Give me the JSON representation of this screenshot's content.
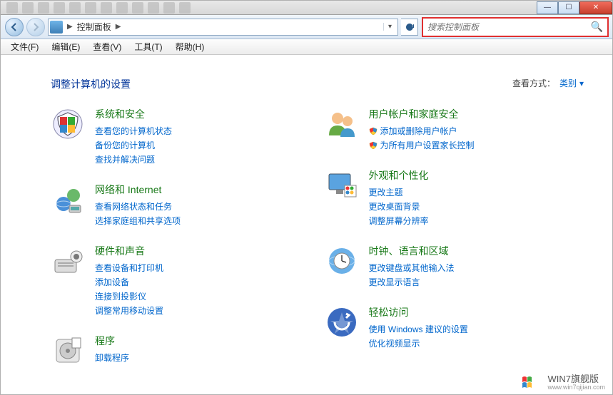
{
  "breadcrumb": {
    "root": "控制面板"
  },
  "search": {
    "placeholder": "搜索控制面板"
  },
  "menus": {
    "file": "文件(F)",
    "edit": "编辑(E)",
    "view": "查看(V)",
    "tools": "工具(T)",
    "help": "帮助(H)"
  },
  "heading": "调整计算机的设置",
  "viewby": {
    "label": "查看方式：",
    "value": "类别"
  },
  "categories": {
    "left": [
      {
        "title": "系统和安全",
        "links": [
          {
            "text": "查看您的计算机状态",
            "shield": false
          },
          {
            "text": "备份您的计算机",
            "shield": false
          },
          {
            "text": "查找并解决问题",
            "shield": false
          }
        ]
      },
      {
        "title": "网络和 Internet",
        "links": [
          {
            "text": "查看网络状态和任务",
            "shield": false
          },
          {
            "text": "选择家庭组和共享选项",
            "shield": false
          }
        ]
      },
      {
        "title": "硬件和声音",
        "links": [
          {
            "text": "查看设备和打印机",
            "shield": false
          },
          {
            "text": "添加设备",
            "shield": false
          },
          {
            "text": "连接到投影仪",
            "shield": false
          },
          {
            "text": "调整常用移动设置",
            "shield": false
          }
        ]
      },
      {
        "title": "程序",
        "links": [
          {
            "text": "卸载程序",
            "shield": false
          }
        ]
      }
    ],
    "right": [
      {
        "title": "用户帐户和家庭安全",
        "links": [
          {
            "text": "添加或删除用户帐户",
            "shield": true
          },
          {
            "text": "为所有用户设置家长控制",
            "shield": true
          }
        ]
      },
      {
        "title": "外观和个性化",
        "links": [
          {
            "text": "更改主题",
            "shield": false
          },
          {
            "text": "更改桌面背景",
            "shield": false
          },
          {
            "text": "调整屏幕分辨率",
            "shield": false
          }
        ]
      },
      {
        "title": "时钟、语言和区域",
        "links": [
          {
            "text": "更改键盘或其他输入法",
            "shield": false
          },
          {
            "text": "更改显示语言",
            "shield": false
          }
        ]
      },
      {
        "title": "轻松访问",
        "links": [
          {
            "text": "使用 Windows 建议的设置",
            "shield": false
          },
          {
            "text": "优化视频显示",
            "shield": false
          }
        ]
      }
    ]
  },
  "footer": {
    "title": "WIN7旗舰版",
    "sub": "www.win7qijian.com"
  }
}
